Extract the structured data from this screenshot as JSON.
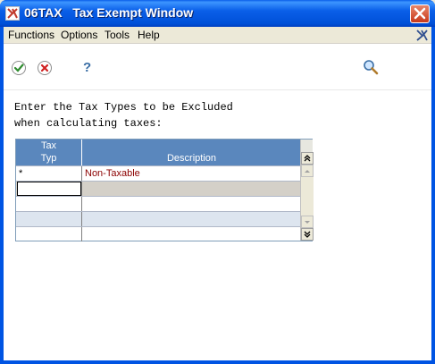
{
  "window": {
    "title": "06TAX   Tax Exempt Window"
  },
  "menu": {
    "items": [
      "Functions",
      "Options",
      "Tools",
      "Help"
    ]
  },
  "toolbar": {
    "ok_icon": "check-icon",
    "cancel_icon": "cancel-icon",
    "help_icon": "help-icon",
    "search_icon": "magnifier-icon"
  },
  "form": {
    "instruction_line1": "Enter the Tax Types to be Excluded",
    "instruction_line2": "when calculating taxes:"
  },
  "grid": {
    "columns": [
      {
        "line1": "Tax",
        "line2": "Typ"
      },
      {
        "line1": "",
        "line2": "Description"
      }
    ],
    "rows": [
      {
        "marker": "*",
        "description": "Non-Taxable"
      },
      {
        "marker": "",
        "description": ""
      },
      {
        "marker": "",
        "description": ""
      },
      {
        "marker": "",
        "description": ""
      },
      {
        "marker": "",
        "description": ""
      }
    ],
    "input_value": ""
  },
  "colors": {
    "header_bg": "#5a87bd",
    "accent_red": "#8b0000",
    "titlebar": "#0054e3"
  }
}
